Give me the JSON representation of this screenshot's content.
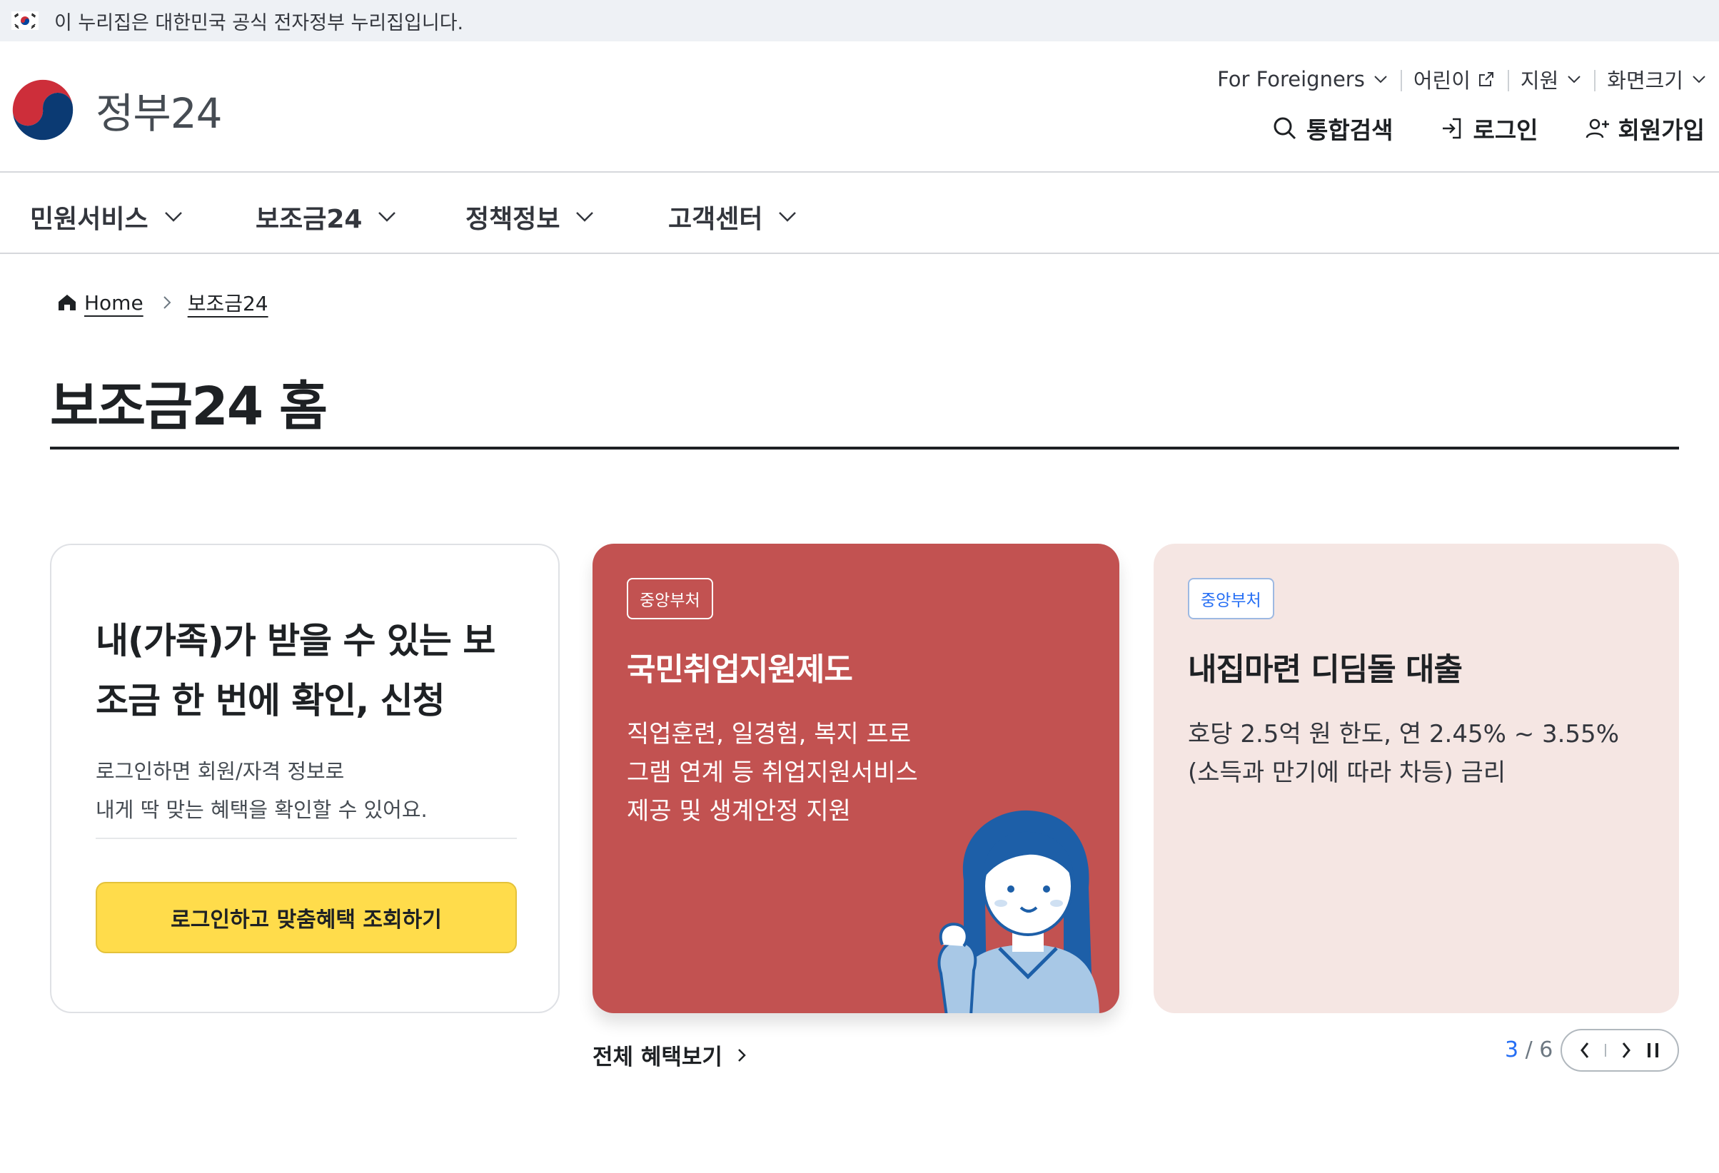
{
  "banner": {
    "text": "이 누리집은 대한민국 공식 전자정부 누리집입니다."
  },
  "header": {
    "logo_text": "정부24",
    "util_nav": [
      {
        "label": "For Foreigners"
      },
      {
        "label": "어린이"
      },
      {
        "label": "지원"
      },
      {
        "label": "화면크기"
      }
    ],
    "main_util": {
      "search": "통합검색",
      "login": "로그인",
      "signup": "회원가입"
    }
  },
  "gnb": {
    "items": [
      {
        "label": "민원서비스"
      },
      {
        "label": "보조금24"
      },
      {
        "label": "정책정보"
      },
      {
        "label": "고객센터"
      }
    ]
  },
  "breadcrumb": {
    "home": "Home",
    "current": "보조금24"
  },
  "page": {
    "title": "보조금24 홈"
  },
  "login_card": {
    "title": "내(가족)가 받을 수 있는 보조금 한 번에 확인, 신청",
    "desc_line1": "로그인하면 회원/자격 정보로",
    "desc_line2": "내게 딱 맞는 혜택을 확인할 수 있어요.",
    "button": "로그인하고 맞춤혜택 조회하기"
  },
  "promos": [
    {
      "tag": "중앙부처",
      "title": "국민취업지원제도",
      "desc": "직업훈련, 일경험, 복지 프로그램 연계 등 취업지원서비스 제공 및 생계안정 지원"
    },
    {
      "tag": "중앙부처",
      "title": "내집마련 디딤돌 대출",
      "desc": "호당 2.5억 원 한도, 연 2.45% ~ 3.55%(소득과 만기에 따라 차등) 금리"
    }
  ],
  "footer_bar": {
    "view_all": "전체 혜택보기",
    "current_page": "3",
    "total_pages": "/ 6"
  },
  "colors": {
    "promo_red": "#c25251",
    "promo_pink": "#f5e6e3",
    "login_button": "#ffdc4b",
    "accent_blue": "#256ef4"
  },
  "icons": [
    "korea-flag-icon",
    "gov-logo-icon",
    "chevron-down-icon",
    "external-link-icon",
    "search-icon",
    "login-icon",
    "user-add-icon",
    "home-icon",
    "chevron-right-icon",
    "prev-icon",
    "next-icon",
    "pause-icon"
  ]
}
